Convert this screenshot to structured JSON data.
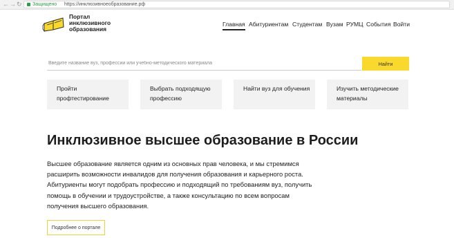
{
  "browser": {
    "back_icon": "arrow-left-icon",
    "forward_icon": "arrow-right-icon",
    "reload_icon": "reload-icon",
    "secure_label": "Защищено",
    "url": "https://инклюзивноеобразование.рф"
  },
  "logo": {
    "line1": "Портал",
    "line2": "инклюзивного",
    "line3": "образования",
    "icon": "book-logo-icon",
    "brand_color": "#f9d92c"
  },
  "nav": {
    "items": [
      "Главная",
      "Абитуриентам",
      "Студентам",
      "Вузам",
      "РУМЦ",
      "События",
      "Войти"
    ],
    "active_index": 0
  },
  "search": {
    "placeholder": "Введите название вуз, профессии или учебно-методического материала",
    "button_label": "Найти"
  },
  "tiles": [
    "Пройти профтестирование",
    "Выбрать подходящую профессию",
    "Найти вуз для обучения",
    "Изучить методические материалы"
  ],
  "main": {
    "title": "Инклюзивное высшее образование в России",
    "body": "Высшее образование является одним из основных прав человека, и мы стремимся расширить возможности инвалидов для получения образования и карьерного роста. Абитуриенты могут подобрать профессию и подходящий по требованиям вуз, получить помощь в обучении и трудоустройстве, а также консультацию по всем вопросам получения высшего образования.",
    "more_button": "Подробнее о портале"
  }
}
